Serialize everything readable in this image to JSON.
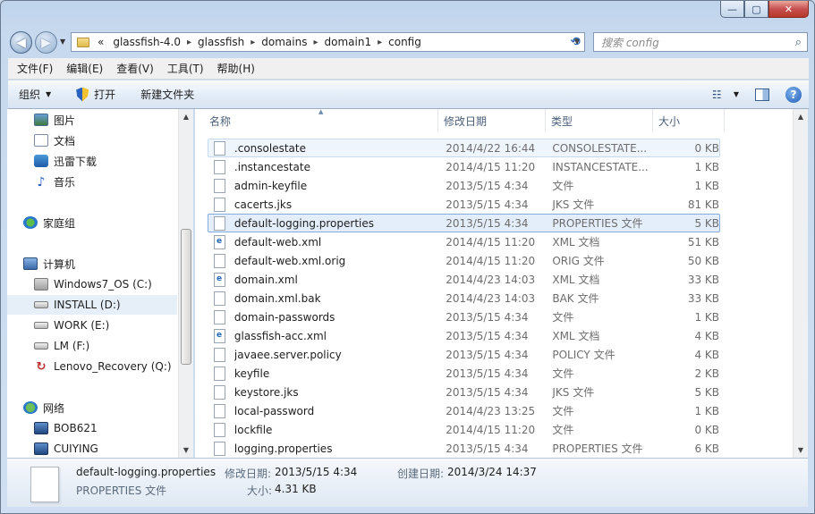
{
  "window": {
    "caption_buttons": {
      "minimize": "—",
      "maximize": "▢",
      "close": "✕"
    }
  },
  "address": {
    "overflow": "«",
    "segments": [
      "glassfish-4.0",
      "glassfish",
      "domains",
      "domain1",
      "config"
    ]
  },
  "search": {
    "placeholder": "搜索 config"
  },
  "menu": [
    "文件(F)",
    "编辑(E)",
    "查看(V)",
    "工具(T)",
    "帮助(H)"
  ],
  "toolbar": {
    "organize": "组织",
    "open": "打开",
    "new_folder": "新建文件夹"
  },
  "nav": {
    "libraries": [
      {
        "label": "图片",
        "icon": "picture-icon"
      },
      {
        "label": "文档",
        "icon": "document-icon"
      },
      {
        "label": "迅雷下载",
        "icon": "thunder-download-icon"
      },
      {
        "label": "音乐",
        "icon": "music-icon"
      }
    ],
    "homegroup": "家庭组",
    "computer": "计算机",
    "drives": [
      {
        "label": "Windows7_OS (C:)",
        "icon": "windows-drive-icon"
      },
      {
        "label": "INSTALL (D:)",
        "icon": "drive-icon",
        "selected": true
      },
      {
        "label": "WORK (E:)",
        "icon": "drive-icon"
      },
      {
        "label": "LM (F:)",
        "icon": "drive-icon"
      },
      {
        "label": "Lenovo_Recovery (Q:)",
        "icon": "recovery-drive-icon"
      }
    ],
    "network": "网络",
    "hosts": [
      "BOB621",
      "CUIYING"
    ]
  },
  "columns": {
    "name": "名称",
    "date": "修改日期",
    "type": "类型",
    "size": "大小"
  },
  "files": [
    {
      "name": ".consolestate",
      "date": "2014/4/22 16:44",
      "type": "CONSOLESTATE...",
      "size": "0 KB",
      "icon": "file-icon",
      "state": "hover"
    },
    {
      "name": ".instancestate",
      "date": "2014/4/15 11:20",
      "type": "INSTANCESTATE...",
      "size": "1 KB",
      "icon": "file-icon"
    },
    {
      "name": "admin-keyfile",
      "date": "2013/5/15 4:34",
      "type": "文件",
      "size": "1 KB",
      "icon": "file-icon"
    },
    {
      "name": "cacerts.jks",
      "date": "2013/5/15 4:34",
      "type": "JKS 文件",
      "size": "81 KB",
      "icon": "file-icon"
    },
    {
      "name": "default-logging.properties",
      "date": "2013/5/15 4:34",
      "type": "PROPERTIES 文件",
      "size": "5 KB",
      "icon": "file-icon",
      "state": "selected"
    },
    {
      "name": "default-web.xml",
      "date": "2014/4/15 11:20",
      "type": "XML 文档",
      "size": "51 KB",
      "icon": "xml-file-icon"
    },
    {
      "name": "default-web.xml.orig",
      "date": "2014/4/15 11:20",
      "type": "ORIG 文件",
      "size": "50 KB",
      "icon": "file-icon"
    },
    {
      "name": "domain.xml",
      "date": "2014/4/23 14:03",
      "type": "XML 文档",
      "size": "33 KB",
      "icon": "xml-file-icon"
    },
    {
      "name": "domain.xml.bak",
      "date": "2014/4/23 14:03",
      "type": "BAK 文件",
      "size": "33 KB",
      "icon": "file-icon"
    },
    {
      "name": "domain-passwords",
      "date": "2013/5/15 4:34",
      "type": "文件",
      "size": "1 KB",
      "icon": "file-icon"
    },
    {
      "name": "glassfish-acc.xml",
      "date": "2013/5/15 4:34",
      "type": "XML 文档",
      "size": "4 KB",
      "icon": "xml-file-icon"
    },
    {
      "name": "javaee.server.policy",
      "date": "2013/5/15 4:34",
      "type": "POLICY 文件",
      "size": "4 KB",
      "icon": "file-icon"
    },
    {
      "name": "keyfile",
      "date": "2013/5/15 4:34",
      "type": "文件",
      "size": "2 KB",
      "icon": "file-icon"
    },
    {
      "name": "keystore.jks",
      "date": "2013/5/15 4:34",
      "type": "JKS 文件",
      "size": "5 KB",
      "icon": "file-icon"
    },
    {
      "name": "local-password",
      "date": "2014/4/23 13:25",
      "type": "文件",
      "size": "1 KB",
      "icon": "file-icon"
    },
    {
      "name": "lockfile",
      "date": "2014/4/15 11:20",
      "type": "文件",
      "size": "0 KB",
      "icon": "file-icon"
    },
    {
      "name": "logging.properties",
      "date": "2013/5/15 4:34",
      "type": "PROPERTIES 文件",
      "size": "6 KB",
      "icon": "file-icon"
    }
  ],
  "details": {
    "filename": "default-logging.properties",
    "filetype": "PROPERTIES 文件",
    "modified_label": "修改日期:",
    "modified_value": "2013/5/15 4:34",
    "created_label": "创建日期:",
    "created_value": "2014/3/24 14:37",
    "size_label": "大小:",
    "size_value": "4.31 KB"
  }
}
